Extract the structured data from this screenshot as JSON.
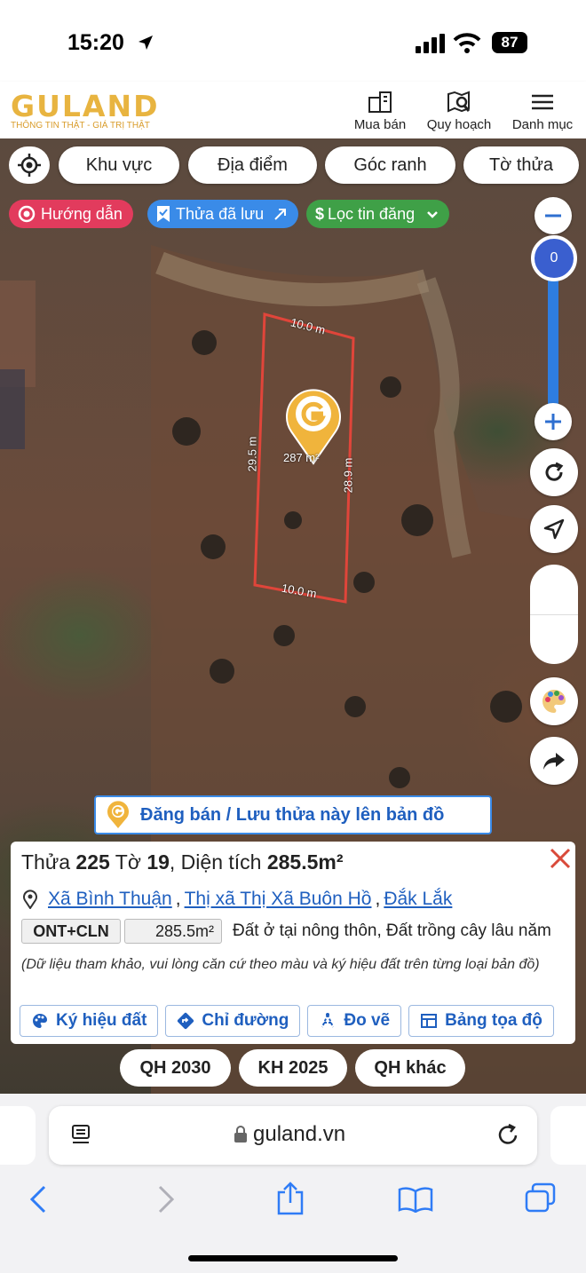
{
  "status": {
    "time": "15:20",
    "battery": "87"
  },
  "header": {
    "logo": "GULAND",
    "tagline": "THÔNG TIN THẬT - GIÁ TRỊ THẬT",
    "nav": [
      "Mua bán",
      "Quy hoạch",
      "Danh mục"
    ]
  },
  "filters": [
    "Khu vực",
    "Địa điểm",
    "Góc ranh",
    "Tờ thửa"
  ],
  "chips": {
    "guide": "Hướng dẫn",
    "saved": "Thửa đã lưu",
    "filter": "Lọc tin đăng"
  },
  "zoom": {
    "level": "0"
  },
  "parcel": {
    "top": "10.0 m",
    "bottom": "10.0 m",
    "left": "29.5 m",
    "right": "28.9 m",
    "area_label": "287 m²"
  },
  "post_button": "Đăng bán / Lưu thửa này lên bản đồ",
  "info": {
    "title_prefix": "Thửa",
    "parcel_no": "225",
    "sheet_prefix": "Tờ",
    "sheet_no": "19",
    "area_prefix": ", Diện tích",
    "area": "285.5m²",
    "commune": "Xã Bình Thuận",
    "district": "Thị xã Thị Xã Buôn Hồ",
    "province": "Đắk Lắk",
    "land_code": "ONT+CLN",
    "land_area": "285.5m²",
    "land_desc": "Đất ở tại nông thôn, Đất trồng cây lâu năm",
    "note": "(Dữ liệu tham khảo, vui lòng căn cứ theo màu và ký hiệu đất trên từng loại bản đồ)",
    "actions": [
      "Ký hiệu đất",
      "Chỉ đường",
      "Đo vẽ",
      "Bảng tọa độ"
    ]
  },
  "plans": [
    "QH 2030",
    "KH 2025",
    "QH khác"
  ],
  "browser": {
    "url": "guland.vn"
  },
  "colors": {
    "brand": "#e8b440",
    "guide": "#e23b5d",
    "saved": "#3a8be8",
    "filter": "#3fa047",
    "zoom": "#2e7de0",
    "parcel": "#e0453a"
  }
}
